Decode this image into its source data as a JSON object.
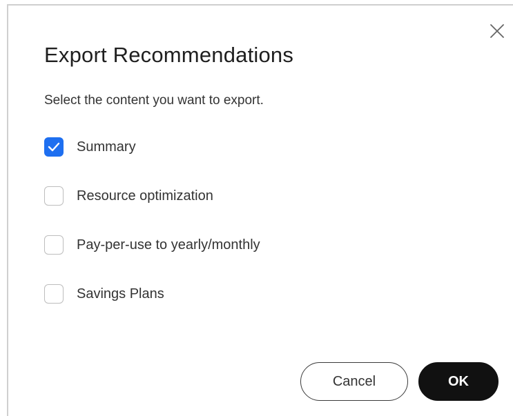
{
  "dialog": {
    "title": "Export Recommendations",
    "subtitle": "Select the content you want to export."
  },
  "options": [
    {
      "label": "Summary",
      "checked": true
    },
    {
      "label": "Resource optimization",
      "checked": false
    },
    {
      "label": "Pay-per-use to yearly/monthly",
      "checked": false
    },
    {
      "label": "Savings Plans",
      "checked": false
    }
  ],
  "buttons": {
    "cancel_label": "Cancel",
    "ok_label": "OK"
  },
  "icons": {
    "close": "close-icon",
    "check": "checkmark-icon"
  },
  "colors": {
    "accent": "#1e6ff0",
    "primary_button": "#111111",
    "text": "#333333"
  }
}
